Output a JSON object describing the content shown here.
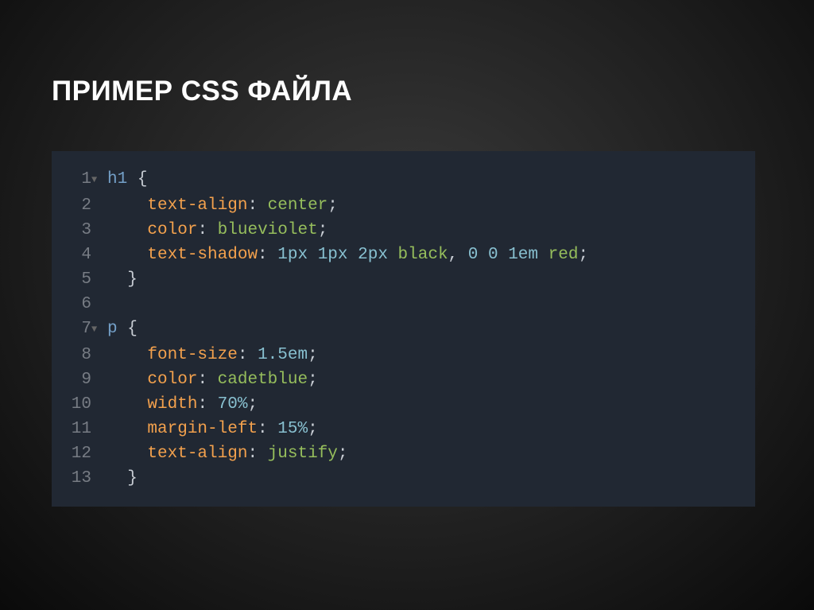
{
  "title": "ПРИМЕР CSS ФАЙЛА",
  "lines": {
    "l1": {
      "no": "1",
      "fold": "▼"
    },
    "l2": {
      "no": "2",
      "fold": ""
    },
    "l3": {
      "no": "3",
      "fold": ""
    },
    "l4": {
      "no": "4",
      "fold": ""
    },
    "l5": {
      "no": "5",
      "fold": ""
    },
    "l6": {
      "no": "6",
      "fold": ""
    },
    "l7": {
      "no": "7",
      "fold": "▼"
    },
    "l8": {
      "no": "8",
      "fold": ""
    },
    "l9": {
      "no": "9",
      "fold": ""
    },
    "l10": {
      "no": "10",
      "fold": ""
    },
    "l11": {
      "no": "11",
      "fold": ""
    },
    "l12": {
      "no": "12",
      "fold": ""
    },
    "l13": {
      "no": "13",
      "fold": ""
    }
  },
  "code": {
    "h1_sel": "h1",
    "p_sel": "p",
    "open": " {",
    "close": "}",
    "indent": "    ",
    "half_indent": "  ",
    "semicolon": ";",
    "colon": ":",
    "sp": " ",
    "comma": ",",
    "props": {
      "text_align": "text-align",
      "color": "color",
      "text_shadow": "text-shadow",
      "font_size": "font-size",
      "width": "width",
      "margin_left": "margin-left"
    },
    "vals": {
      "center": "center",
      "blueviolet": "blueviolet",
      "px1a": "1px",
      "px1b": "1px",
      "px2": "2px",
      "black": "black",
      "z0a": "0",
      "z0b": "0",
      "em1": "1em",
      "red": "red",
      "em1_5": "1.5em",
      "cadetblue": "cadetblue",
      "pct70": "70%",
      "pct15": "15%",
      "justify": "justify"
    }
  }
}
